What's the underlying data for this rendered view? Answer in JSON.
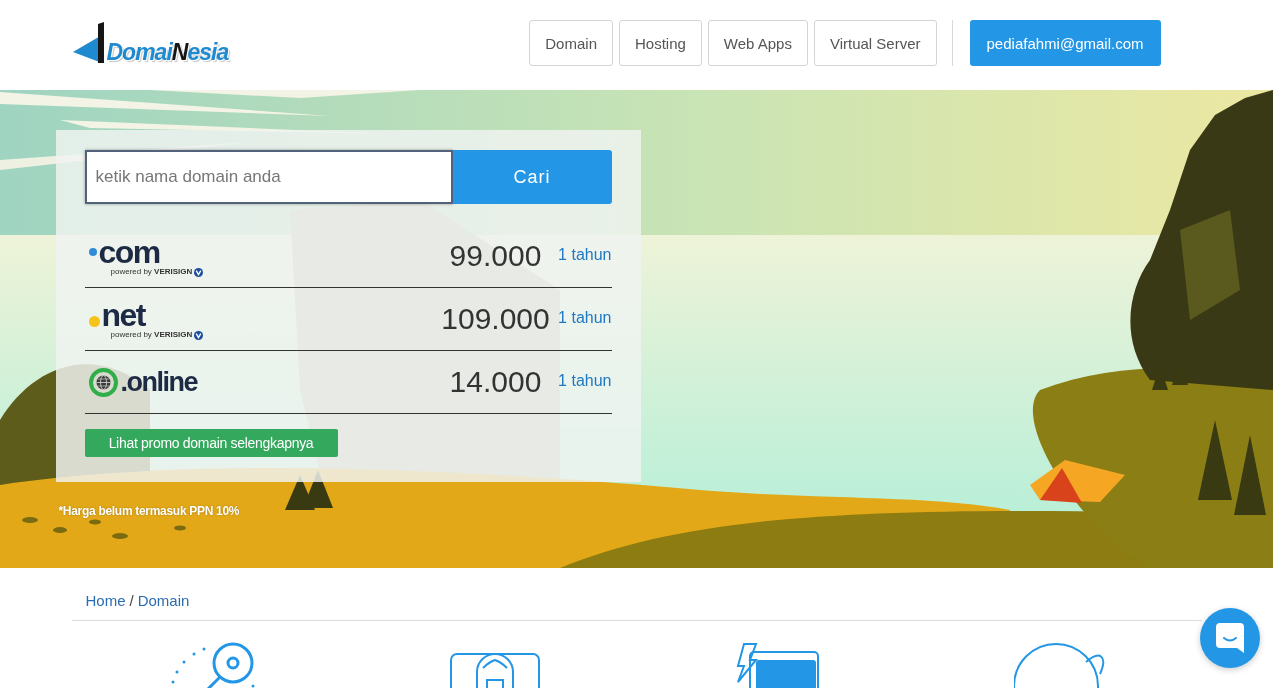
{
  "header": {
    "logo": {
      "text": "Domai**N**esia"
    },
    "nav": [
      {
        "label": "Domain"
      },
      {
        "label": "Hosting"
      },
      {
        "label": "Web Apps"
      },
      {
        "label": "Virtual Server"
      }
    ],
    "account": {
      "label": "pediafahmi@gmail.com"
    }
  },
  "search": {
    "placeholder": "ketik nama domain anda",
    "button": "Cari"
  },
  "domains": [
    {
      "kind": "dot",
      "name": "com",
      "color": "#2e8bd6",
      "tagline": "powered by **VERISIGN**",
      "price": "99.000",
      "period": "1 tahun"
    },
    {
      "kind": "dot",
      "name": "net",
      "color": "#f5c31a",
      "tagline": "powered by **VERISIGN**",
      "price": "109.000",
      "period": "1 tahun"
    },
    {
      "kind": "globe",
      "name": ".online",
      "price": "14.000",
      "period": "1 tahun"
    }
  ],
  "promo_button": "Lihat promo domain selengkapnya",
  "footnote": "*Harga belum termasuk PPN 10%",
  "breadcrumb": {
    "items": [
      {
        "label": "Home"
      },
      {
        "label": "Domain"
      }
    ],
    "separator": "/"
  }
}
